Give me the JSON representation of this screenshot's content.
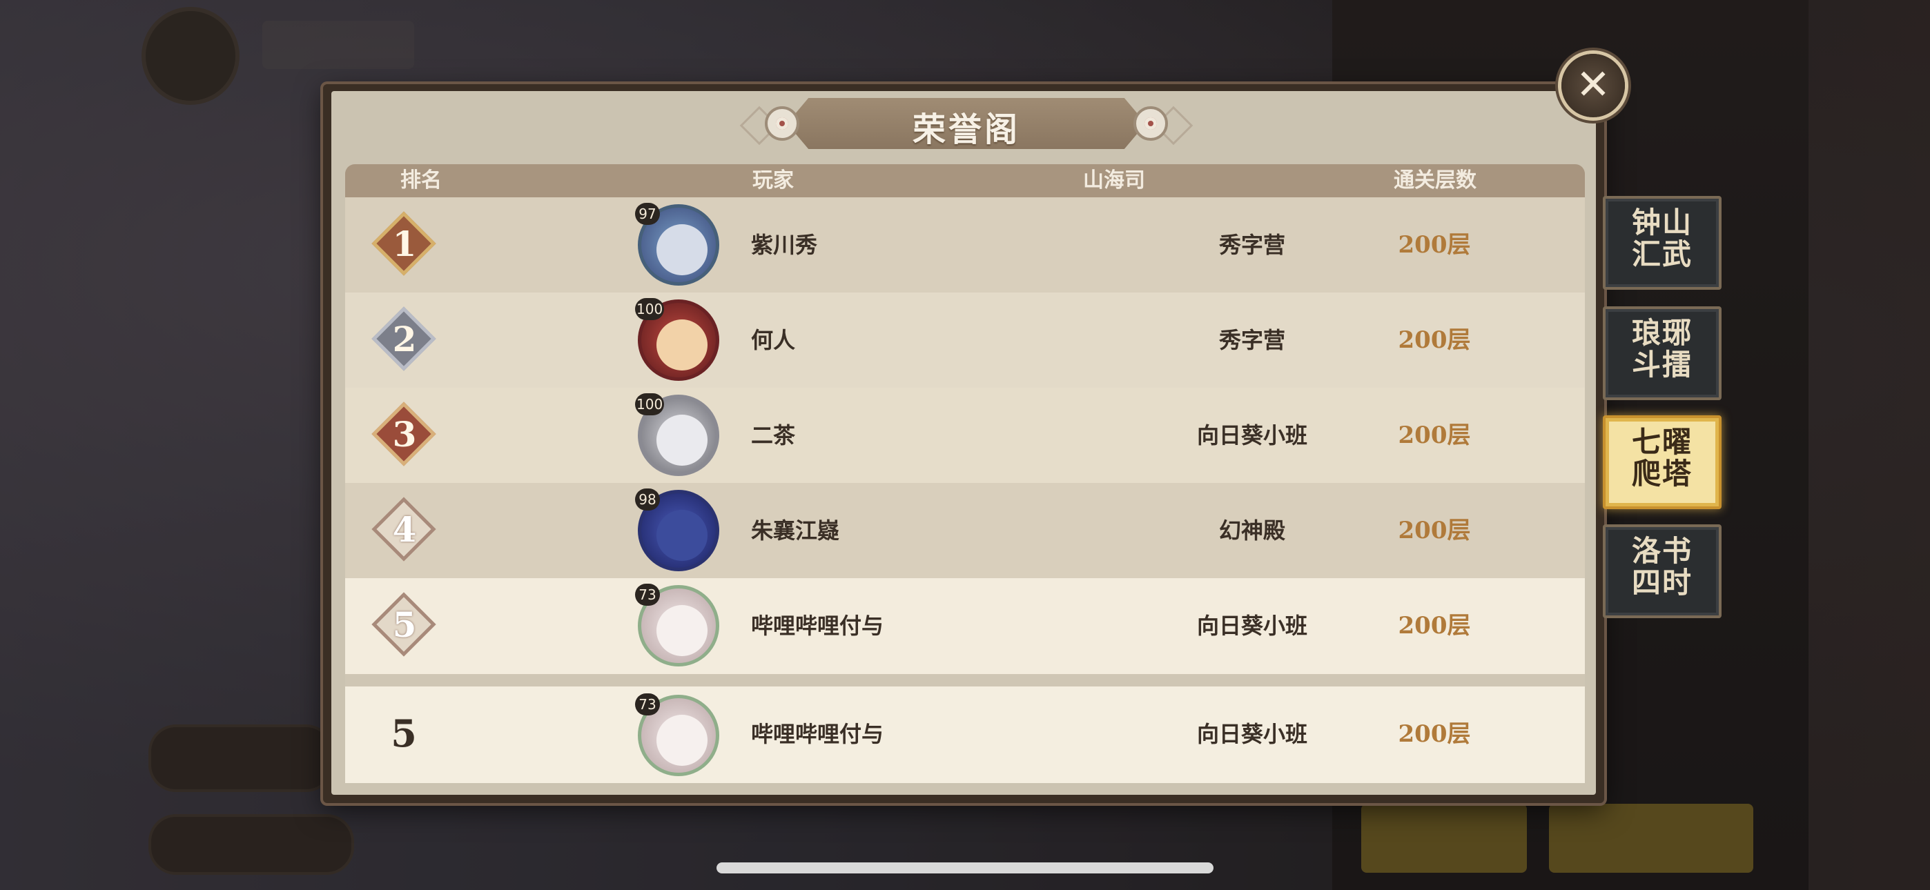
{
  "dialog": {
    "title": "荣誉阁",
    "close_icon": "close-icon"
  },
  "table": {
    "headers": {
      "rank": "排名",
      "player": "玩家",
      "guild": "山海司",
      "floors": "通关层数"
    },
    "rows": [
      {
        "rank": "1",
        "level": "97",
        "name": "紫川秀",
        "guild": "秀字营",
        "floors": "200层",
        "badge_color": "#9a5a3c",
        "avatar_color": "#3c4a7a"
      },
      {
        "rank": "2",
        "level": "100",
        "name": "何人",
        "guild": "秀字营",
        "floors": "200层",
        "badge_color": "#7c7f8a",
        "avatar_color": "#8a2a2c"
      },
      {
        "rank": "3",
        "level": "100",
        "name": "二茶",
        "guild": "向日葵小班",
        "floors": "200层",
        "badge_color": "#9a4c3a",
        "avatar_color": "#8f8f96"
      },
      {
        "rank": "4",
        "level": "98",
        "name": "朱襄江嶷",
        "guild": "幻神殿",
        "floors": "200层",
        "badge_color": "#d6c6b2",
        "avatar_color": "#2a3270"
      },
      {
        "rank": "5",
        "level": "73",
        "name": "哔哩哔哩付与",
        "guild": "向日葵小班",
        "floors": "200层",
        "badge_color": "#d6c6b2",
        "avatar_color": "#d8c8c8"
      }
    ],
    "self_row": {
      "rank": "5",
      "level": "73",
      "name": "哔哩哔哩付与",
      "guild": "向日葵小班",
      "floors": "200层"
    }
  },
  "side_tabs": [
    {
      "label_line1": "钟山",
      "label_line2": "汇武",
      "active": false
    },
    {
      "label_line1": "琅琊",
      "label_line2": "斗擂",
      "active": false
    },
    {
      "label_line1": "七曜",
      "label_line2": "爬塔",
      "active": true
    },
    {
      "label_line1": "洛书",
      "label_line2": "四时",
      "active": false
    }
  ],
  "colors": {
    "floor_text": "#b07a3a",
    "active_tab": "#f4e2a4"
  }
}
